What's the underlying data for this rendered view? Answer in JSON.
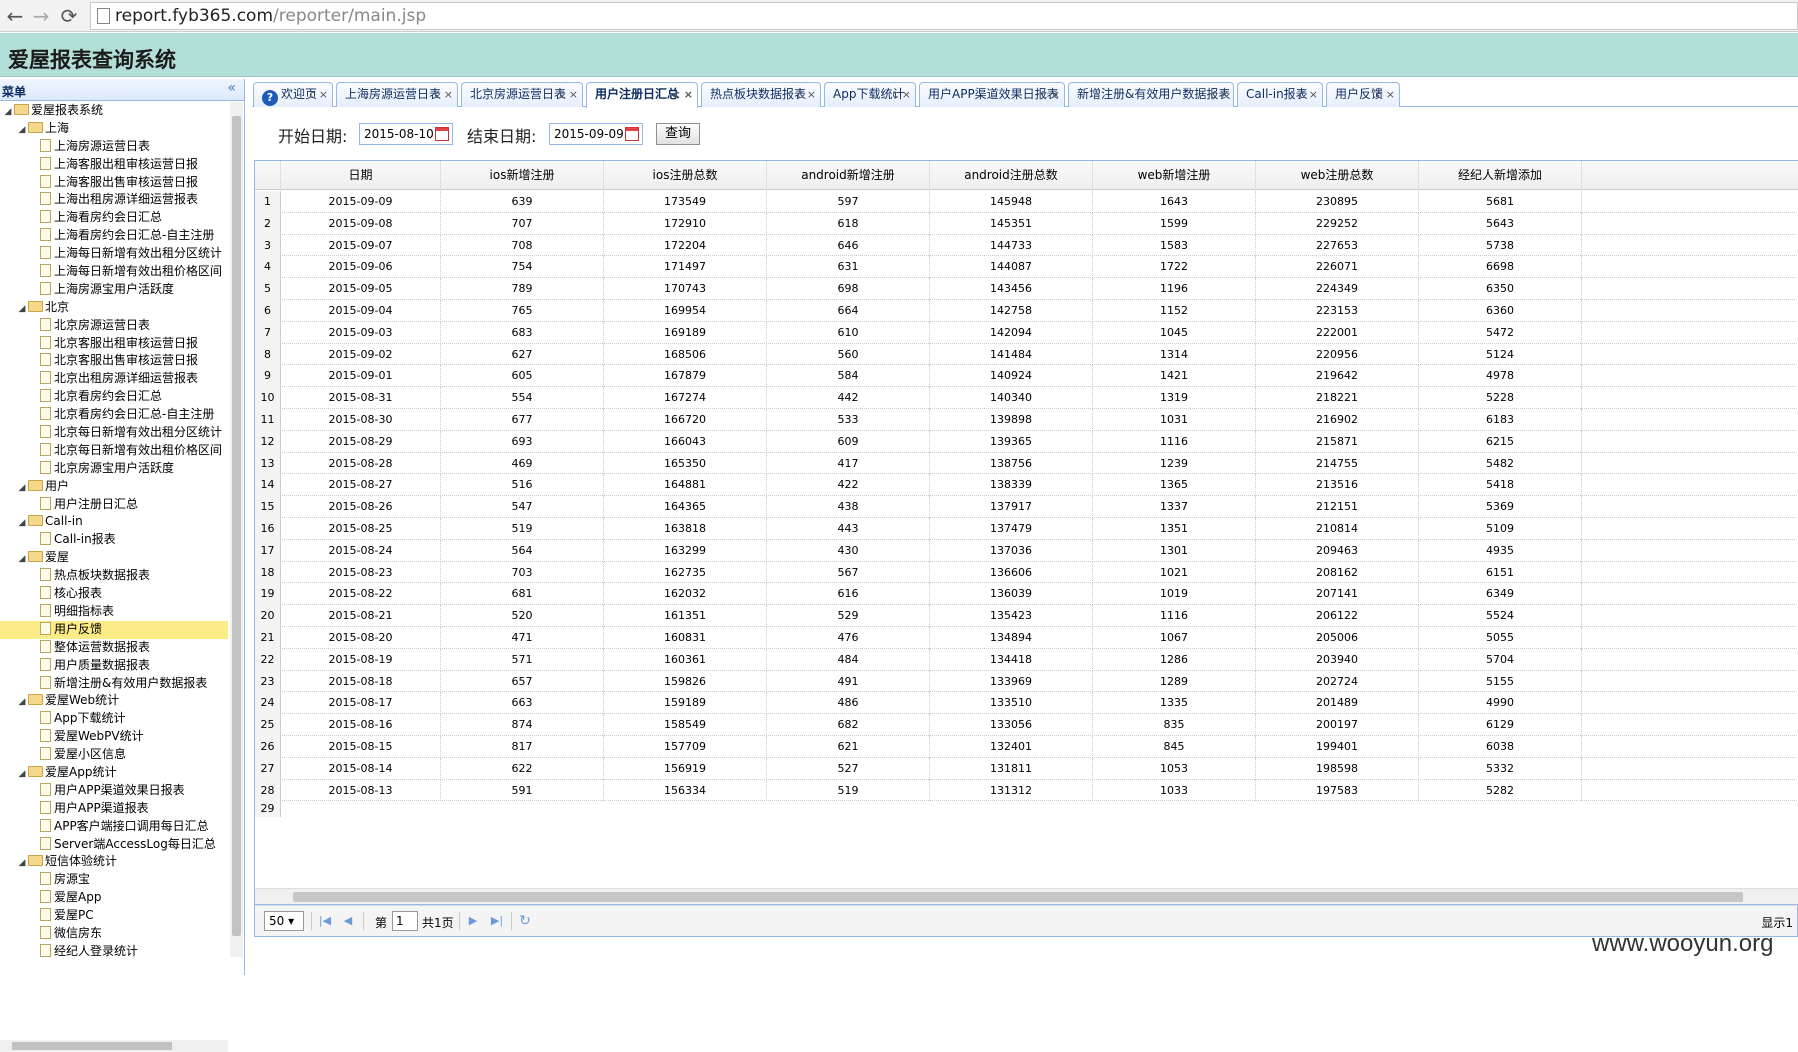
{
  "browser": {
    "url_host": "report.fyb365.com",
    "url_path": "/reporter/main.jsp"
  },
  "app": {
    "title": "爱屋报表查询系统"
  },
  "sidebar": {
    "title": "菜单",
    "tree": [
      {
        "label": "爱屋报表系统",
        "level": 0,
        "type": "folder"
      },
      {
        "label": "上海",
        "level": 1,
        "type": "folder"
      },
      {
        "label": "上海房源运营日表",
        "level": 2,
        "type": "file"
      },
      {
        "label": "上海客服出租审核运营日报",
        "level": 2,
        "type": "file"
      },
      {
        "label": "上海客服出售审核运营日报",
        "level": 2,
        "type": "file"
      },
      {
        "label": "上海出租房源详细运营报表",
        "level": 2,
        "type": "file"
      },
      {
        "label": "上海看房约会日汇总",
        "level": 2,
        "type": "file"
      },
      {
        "label": "上海看房约会日汇总-自主注册",
        "level": 2,
        "type": "file"
      },
      {
        "label": "上海每日新增有效出租分区统计",
        "level": 2,
        "type": "file"
      },
      {
        "label": "上海每日新增有效出租价格区间",
        "level": 2,
        "type": "file"
      },
      {
        "label": "上海房源宝用户活跃度",
        "level": 2,
        "type": "file"
      },
      {
        "label": "北京",
        "level": 1,
        "type": "folder"
      },
      {
        "label": "北京房源运营日表",
        "level": 2,
        "type": "file"
      },
      {
        "label": "北京客服出租审核运营日报",
        "level": 2,
        "type": "file"
      },
      {
        "label": "北京客服出售审核运营日报",
        "level": 2,
        "type": "file"
      },
      {
        "label": "北京出租房源详细运营报表",
        "level": 2,
        "type": "file"
      },
      {
        "label": "北京看房约会日汇总",
        "level": 2,
        "type": "file"
      },
      {
        "label": "北京看房约会日汇总-自主注册",
        "level": 2,
        "type": "file"
      },
      {
        "label": "北京每日新增有效出租分区统计",
        "level": 2,
        "type": "file"
      },
      {
        "label": "北京每日新增有效出租价格区间",
        "level": 2,
        "type": "file"
      },
      {
        "label": "北京房源宝用户活跃度",
        "level": 2,
        "type": "file"
      },
      {
        "label": "用户",
        "level": 1,
        "type": "folder"
      },
      {
        "label": "用户注册日汇总",
        "level": 2,
        "type": "file"
      },
      {
        "label": "Call-in",
        "level": 1,
        "type": "folder"
      },
      {
        "label": "Call-in报表",
        "level": 2,
        "type": "file"
      },
      {
        "label": "爱屋",
        "level": 1,
        "type": "folder"
      },
      {
        "label": "热点板块数据报表",
        "level": 2,
        "type": "file"
      },
      {
        "label": "核心报表",
        "level": 2,
        "type": "file"
      },
      {
        "label": "明细指标表",
        "level": 2,
        "type": "file"
      },
      {
        "label": "用户反馈",
        "level": 2,
        "type": "file",
        "selected": true
      },
      {
        "label": "整体运营数据报表",
        "level": 2,
        "type": "file"
      },
      {
        "label": "用户质量数据报表",
        "level": 2,
        "type": "file"
      },
      {
        "label": "新增注册&有效用户数据报表",
        "level": 2,
        "type": "file"
      },
      {
        "label": "爱屋Web统计",
        "level": 1,
        "type": "folder"
      },
      {
        "label": "App下载统计",
        "level": 2,
        "type": "file"
      },
      {
        "label": "爱屋WebPV统计",
        "level": 2,
        "type": "file"
      },
      {
        "label": "爱屋小区信息",
        "level": 2,
        "type": "file"
      },
      {
        "label": "爱屋App统计",
        "level": 1,
        "type": "folder"
      },
      {
        "label": "用户APP渠道效果日报表",
        "level": 2,
        "type": "file"
      },
      {
        "label": "用户APP渠道报表",
        "level": 2,
        "type": "file"
      },
      {
        "label": "APP客户端接口调用每日汇总",
        "level": 2,
        "type": "file"
      },
      {
        "label": "Server端AccessLog每日汇总",
        "level": 2,
        "type": "file"
      },
      {
        "label": "短信体验统计",
        "level": 1,
        "type": "folder"
      },
      {
        "label": "房源宝",
        "level": 2,
        "type": "file"
      },
      {
        "label": "爱屋App",
        "level": 2,
        "type": "file"
      },
      {
        "label": "爱屋PC",
        "level": 2,
        "type": "file"
      },
      {
        "label": "微信房东",
        "level": 2,
        "type": "file"
      },
      {
        "label": "经纪人登录统计",
        "level": 2,
        "type": "file"
      }
    ]
  },
  "tabs": [
    {
      "label": "欢迎页",
      "icon": "help-icon"
    },
    {
      "label": "上海房源运营日表"
    },
    {
      "label": "北京房源运营日表"
    },
    {
      "label": "用户注册日汇总",
      "active": true
    },
    {
      "label": "热点板块数据报表"
    },
    {
      "label": "App下载统计"
    },
    {
      "label": "用户APP渠道效果日报表"
    },
    {
      "label": "新增注册&有效用户数据报表"
    },
    {
      "label": "Call-in报表"
    },
    {
      "label": "用户反馈"
    }
  ],
  "tab_controls": "c ×",
  "search": {
    "start_label": "开始日期:",
    "start_value": "2015-08-10",
    "end_label": "结束日期:",
    "end_value": "2015-09-09",
    "query_label": "查询"
  },
  "grid": {
    "columns": [
      "日期",
      "ios新增注册",
      "ios注册总数",
      "android新增注册",
      "android注册总数",
      "web新增注册",
      "web注册总数",
      "经纪人新增添加"
    ],
    "rows": [
      [
        "2015-09-09",
        "639",
        "173549",
        "597",
        "145948",
        "1643",
        "230895",
        "5681"
      ],
      [
        "2015-09-08",
        "707",
        "172910",
        "618",
        "145351",
        "1599",
        "229252",
        "5643"
      ],
      [
        "2015-09-07",
        "708",
        "172204",
        "646",
        "144733",
        "1583",
        "227653",
        "5738"
      ],
      [
        "2015-09-06",
        "754",
        "171497",
        "631",
        "144087",
        "1722",
        "226071",
        "6698"
      ],
      [
        "2015-09-05",
        "789",
        "170743",
        "698",
        "143456",
        "1196",
        "224349",
        "6350"
      ],
      [
        "2015-09-04",
        "765",
        "169954",
        "664",
        "142758",
        "1152",
        "223153",
        "6360"
      ],
      [
        "2015-09-03",
        "683",
        "169189",
        "610",
        "142094",
        "1045",
        "222001",
        "5472"
      ],
      [
        "2015-09-02",
        "627",
        "168506",
        "560",
        "141484",
        "1314",
        "220956",
        "5124"
      ],
      [
        "2015-09-01",
        "605",
        "167879",
        "584",
        "140924",
        "1421",
        "219642",
        "4978"
      ],
      [
        "2015-08-31",
        "554",
        "167274",
        "442",
        "140340",
        "1319",
        "218221",
        "5228"
      ],
      [
        "2015-08-30",
        "677",
        "166720",
        "533",
        "139898",
        "1031",
        "216902",
        "6183"
      ],
      [
        "2015-08-29",
        "693",
        "166043",
        "609",
        "139365",
        "1116",
        "215871",
        "6215"
      ],
      [
        "2015-08-28",
        "469",
        "165350",
        "417",
        "138756",
        "1239",
        "214755",
        "5482"
      ],
      [
        "2015-08-27",
        "516",
        "164881",
        "422",
        "138339",
        "1365",
        "213516",
        "5418"
      ],
      [
        "2015-08-26",
        "547",
        "164365",
        "438",
        "137917",
        "1337",
        "212151",
        "5369"
      ],
      [
        "2015-08-25",
        "519",
        "163818",
        "443",
        "137479",
        "1351",
        "210814",
        "5109"
      ],
      [
        "2015-08-24",
        "564",
        "163299",
        "430",
        "137036",
        "1301",
        "209463",
        "4935"
      ],
      [
        "2015-08-23",
        "703",
        "162735",
        "567",
        "136606",
        "1021",
        "208162",
        "6151"
      ],
      [
        "2015-08-22",
        "681",
        "162032",
        "616",
        "136039",
        "1019",
        "207141",
        "6349"
      ],
      [
        "2015-08-21",
        "520",
        "161351",
        "529",
        "135423",
        "1116",
        "206122",
        "5524"
      ],
      [
        "2015-08-20",
        "471",
        "160831",
        "476",
        "134894",
        "1067",
        "205006",
        "5055"
      ],
      [
        "2015-08-19",
        "571",
        "160361",
        "484",
        "134418",
        "1286",
        "203940",
        "5704"
      ],
      [
        "2015-08-18",
        "657",
        "159826",
        "491",
        "133969",
        "1289",
        "202724",
        "5155"
      ],
      [
        "2015-08-17",
        "663",
        "159189",
        "486",
        "133510",
        "1335",
        "201489",
        "4990"
      ],
      [
        "2015-08-16",
        "874",
        "158549",
        "682",
        "133056",
        "835",
        "200197",
        "6129"
      ],
      [
        "2015-08-15",
        "817",
        "157709",
        "621",
        "132401",
        "845",
        "199401",
        "6038"
      ],
      [
        "2015-08-14",
        "622",
        "156919",
        "527",
        "131811",
        "1053",
        "198598",
        "5332"
      ],
      [
        "2015-08-13",
        "591",
        "156334",
        "519",
        "131312",
        "1033",
        "197583",
        "5282"
      ]
    ],
    "partial_row_number": "29"
  },
  "pager": {
    "page_size": "50",
    "page_prefix": "第",
    "page_value": "1",
    "page_total": "共1页",
    "info": "显示1"
  },
  "watermark": "www.wooyun.org"
}
